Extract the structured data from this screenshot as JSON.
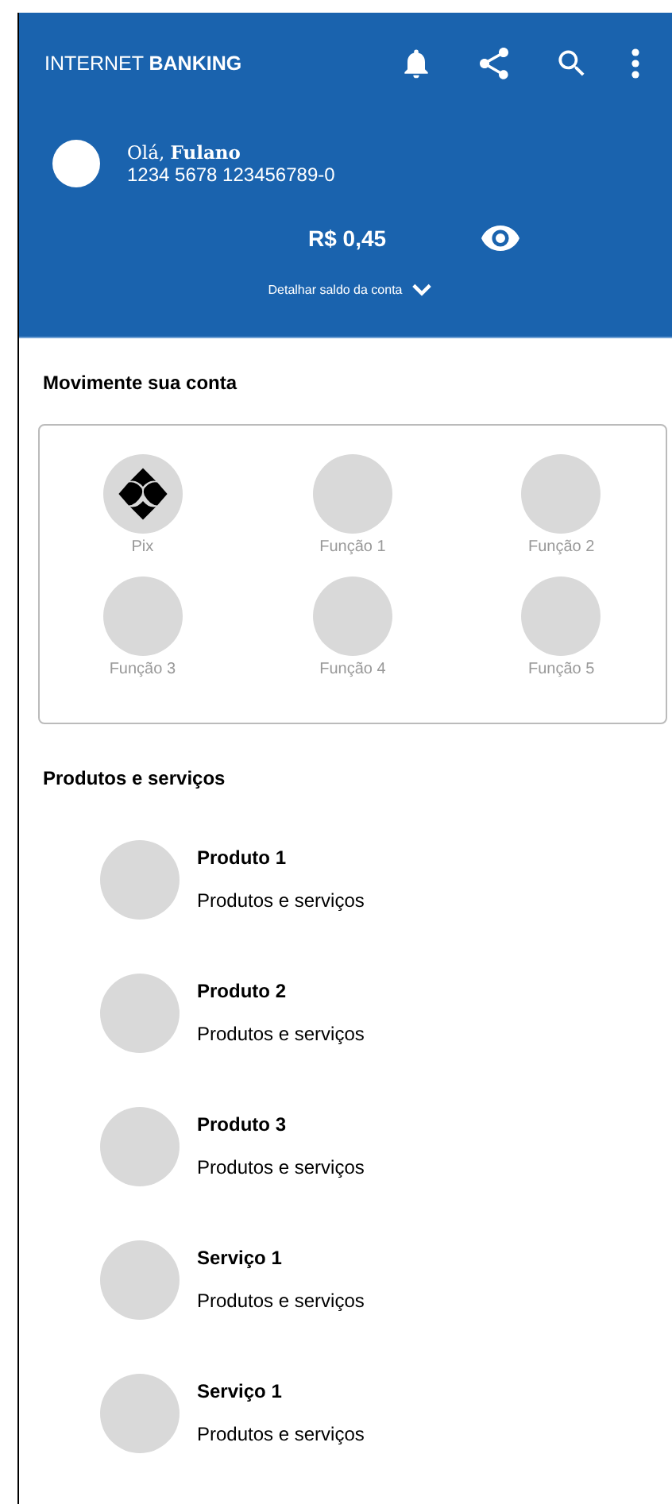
{
  "header": {
    "title": "INTERNET **BANKING**",
    "greeting": "Olá, **Fulano**",
    "account": "1234 5678 123456789-0",
    "balance": "R$ 0,45",
    "details_link": "Detalhar saldo da conta"
  },
  "actions": {
    "title": "Movimente sua conta",
    "items": [
      {
        "label": "Pix",
        "kind": "pix"
      },
      {
        "label": "Função 1",
        "kind": "placeholder"
      },
      {
        "label": "Função 2",
        "kind": "placeholder"
      },
      {
        "label": "Função 3",
        "kind": "placeholder"
      },
      {
        "label": "Função 4",
        "kind": "placeholder"
      },
      {
        "label": "Função 5",
        "kind": "placeholder"
      }
    ]
  },
  "products": {
    "title": "Produtos e serviços",
    "items": [
      {
        "name": "Produto 1",
        "description": "Produtos e serviços"
      },
      {
        "name": "Produto 2",
        "description": "Produtos e serviços"
      },
      {
        "name": "Produto 3",
        "description": "Produtos e serviços"
      },
      {
        "name": "Serviço 1",
        "description": "Produtos e serviços"
      },
      {
        "name": "Serviço 1",
        "description": "Produtos e serviços"
      }
    ]
  }
}
